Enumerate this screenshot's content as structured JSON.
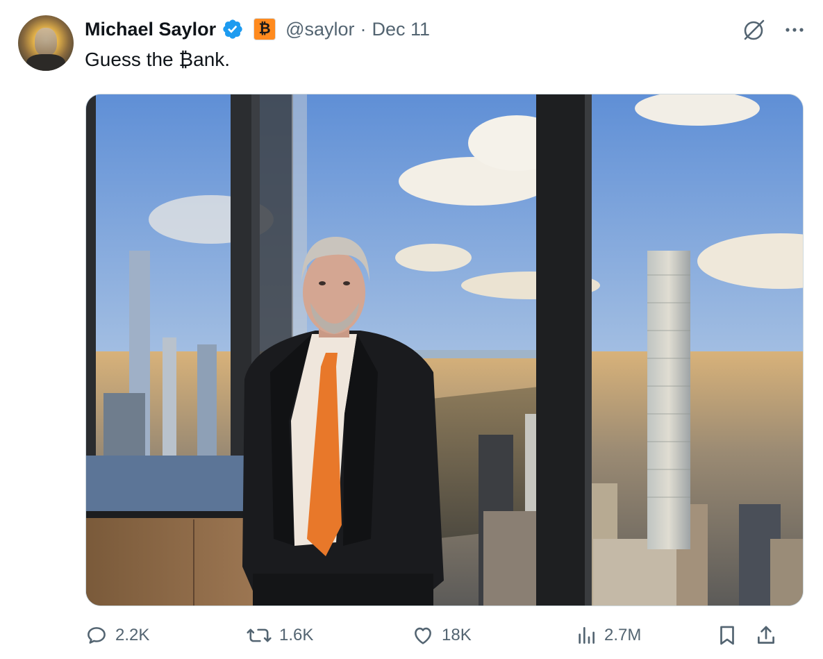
{
  "tweet": {
    "author_name": "Michael Saylor",
    "badge_symbol": "₿",
    "handle": "@saylor",
    "separator": "·",
    "date": "Dec 11",
    "text": "Guess the ₿ank."
  },
  "icons": {
    "verified": "verified-badge-icon",
    "bitcoin_badge": "bitcoin-affiliate-badge-icon",
    "grok": "grok-icon",
    "more": "more-options-icon",
    "reply": "reply-icon",
    "retweet": "retweet-icon",
    "like": "like-icon",
    "views": "views-icon",
    "bookmark": "bookmark-icon",
    "share": "share-icon"
  },
  "actions": {
    "replies": "2.2K",
    "retweets": "1.6K",
    "likes": "18K",
    "views": "2.7M"
  },
  "colors": {
    "text_primary": "#0f1419",
    "text_secondary": "#536471",
    "verified_blue": "#1d9bf0",
    "bitcoin_orange": "#ff8a1e",
    "tie_orange": "#e8782a"
  }
}
